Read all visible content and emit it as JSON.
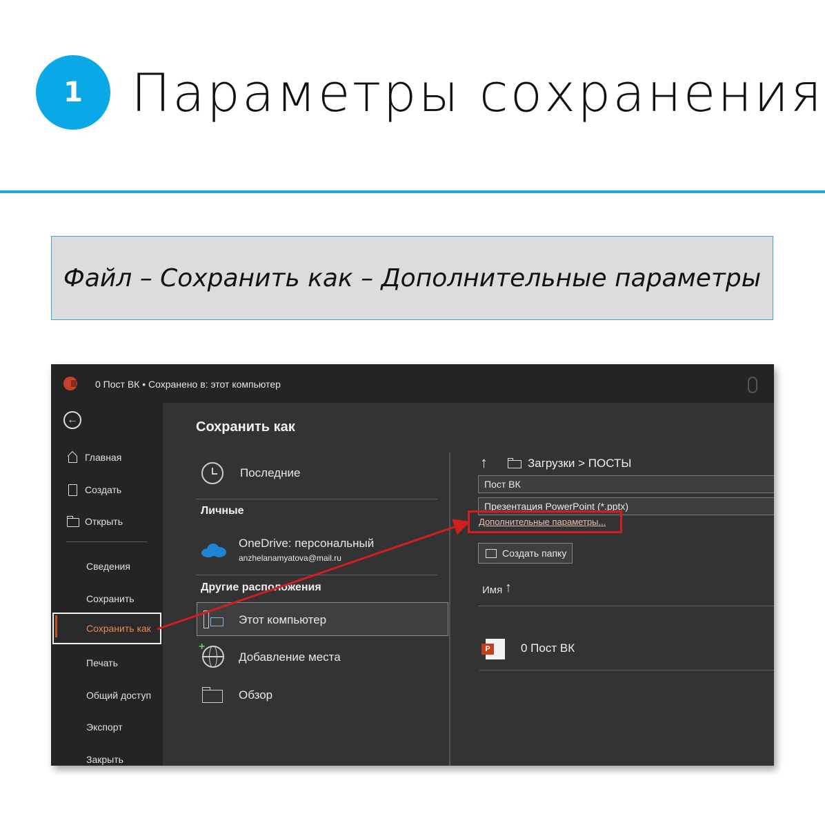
{
  "step": {
    "number": "1",
    "title": "Параметры сохранения"
  },
  "path_text": "Файл – Сохранить как – Дополнительные параметры",
  "window": {
    "title": "0 Пост ВК  •  Сохранено в: этот компьютер"
  },
  "nav": {
    "items_top": [
      {
        "icon": "home-icon",
        "label": "Главная"
      },
      {
        "icon": "new-document-icon",
        "label": "Создать"
      },
      {
        "icon": "open-folder-icon",
        "label": "Открыть"
      }
    ],
    "items_bottom": [
      "Сведения",
      "Сохранить",
      "Сохранить как",
      "Печать",
      "Общий доступ",
      "Экспорт",
      "Закрыть"
    ],
    "active": "Сохранить как"
  },
  "save_as": {
    "heading": "Сохранить как",
    "recent_label": "Последние",
    "personal_group": "Личные",
    "onedrive_label": "OneDrive: персональный",
    "onedrive_email": "anzhelanamyatova@mail.ru",
    "other_group": "Другие расположения",
    "this_pc_label": "Этот компьютер",
    "add_place_label": "Добавление места",
    "browse_label": "Обзор"
  },
  "right_pane": {
    "breadcrumb": "Загрузки > ПОСТЫ",
    "filename_value": "Пост ВК",
    "filetype_value": "Презентация PowerPoint (*.pptx)",
    "more_options_link": "Дополнительные параметры...",
    "new_folder_button": "Создать папку",
    "column_name": "Имя",
    "files": [
      "0 Пост ВК"
    ]
  },
  "colors": {
    "accent_blue": "#0aa8e6",
    "highlight_red": "#d21e1e",
    "active_orange": "#e88a5a",
    "onedrive_blue": "#1f84d6"
  }
}
